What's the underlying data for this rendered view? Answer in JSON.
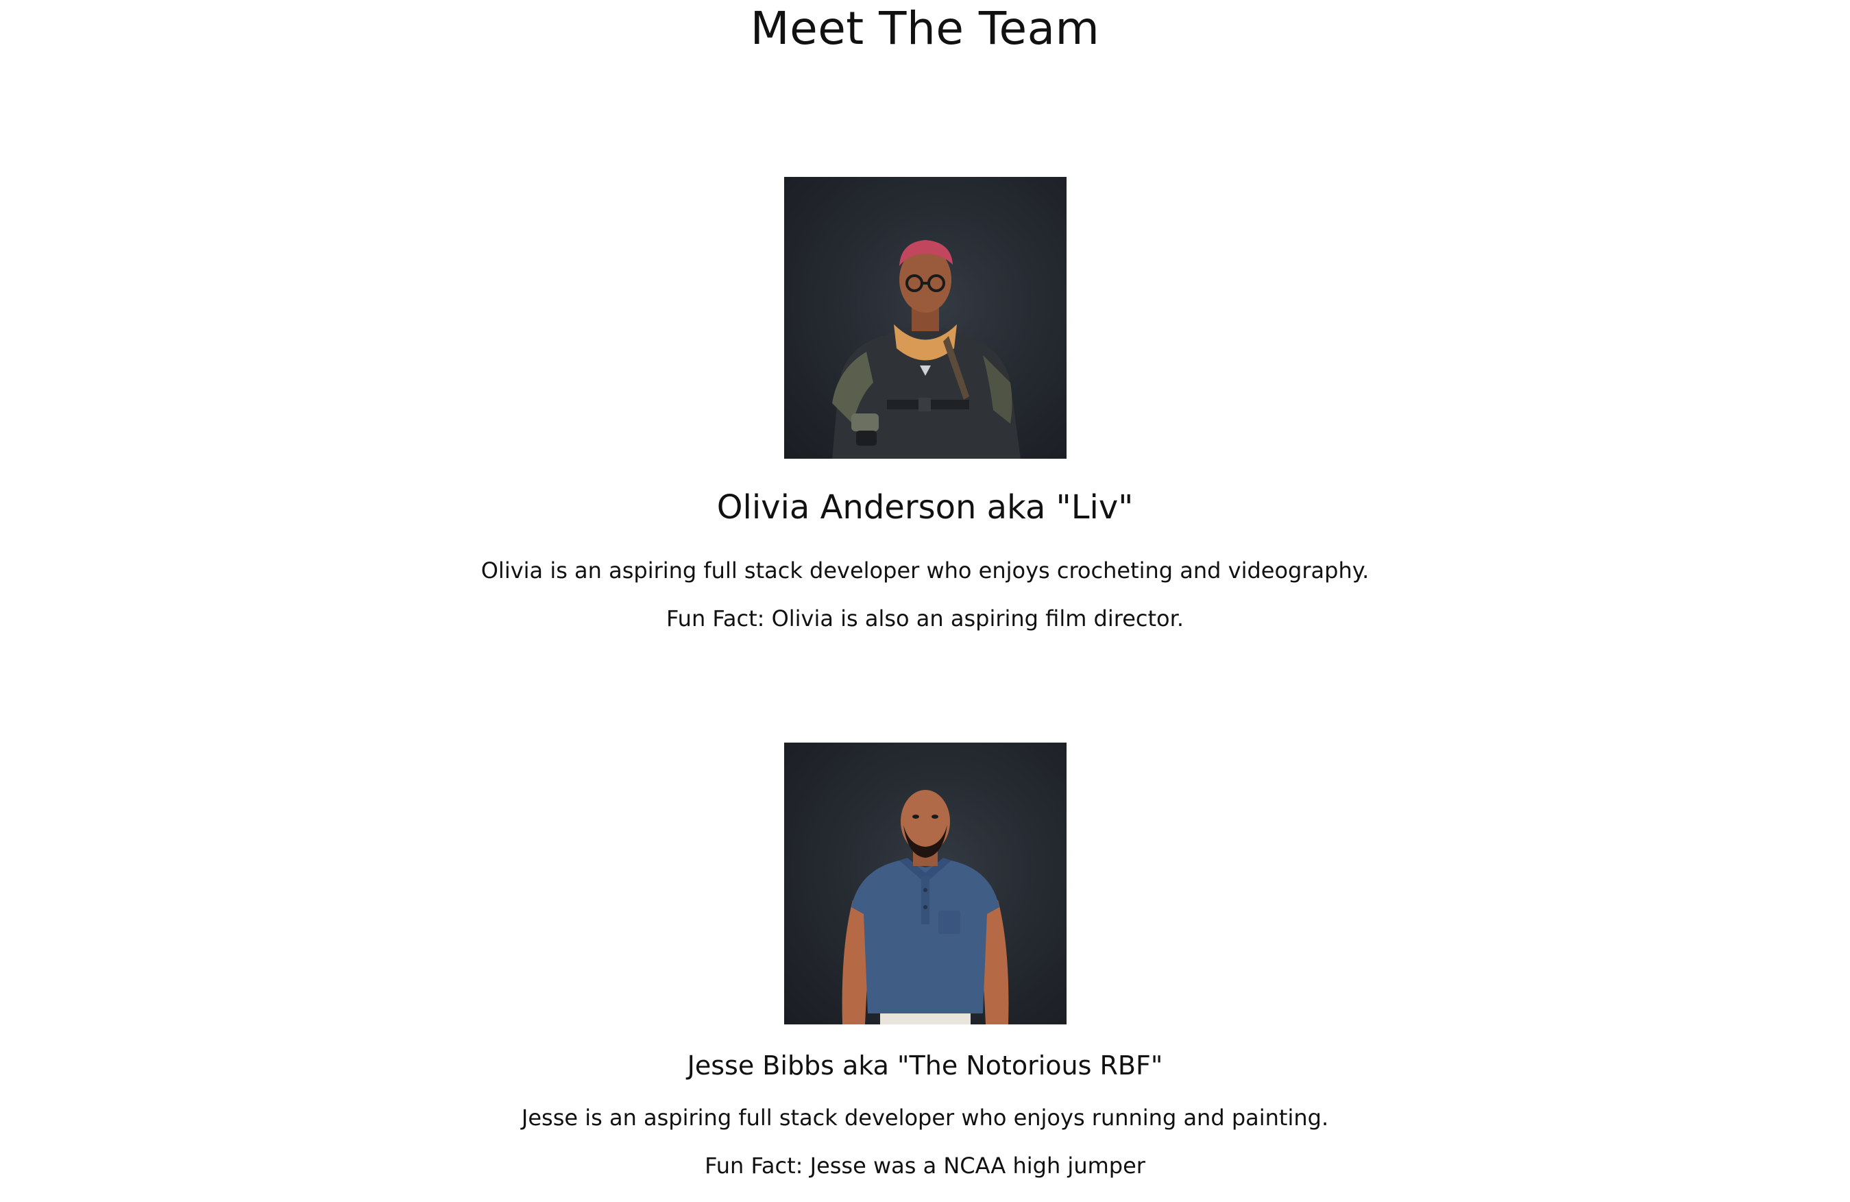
{
  "page": {
    "title": "Meet The Team"
  },
  "team": [
    {
      "name": "Olivia Anderson aka \"Liv\"",
      "description": "Olivia is an aspiring full stack developer who enjoys crocheting and videography.",
      "fun_fact": "Fun Fact: Olivia is also an aspiring film director.",
      "avatar_icon": "avatar-3d-woman-icon"
    },
    {
      "name": "Jesse Bibbs aka \"The Notorious RBF\"",
      "description": "Jesse is an aspiring full stack developer who enjoys running and painting.",
      "fun_fact": "Fun Fact: Jesse was a NCAA high jumper",
      "avatar_icon": "avatar-3d-man-icon"
    }
  ],
  "colors": {
    "background": "#ffffff",
    "text": "#111111",
    "avatar_bg": "#262b32"
  }
}
